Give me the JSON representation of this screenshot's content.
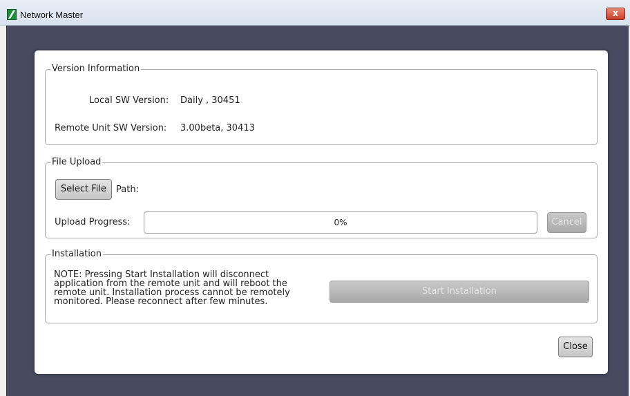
{
  "window": {
    "title": "Network Master",
    "close_glyph": "x"
  },
  "icons": {
    "app": "network-master-app-icon",
    "close": "close-icon"
  },
  "version_info": {
    "legend": "Version Information",
    "local_label": "Local SW Version:",
    "local_value": "Daily , 30451",
    "remote_label": "Remote Unit SW Version:",
    "remote_value": "3.00beta, 30413"
  },
  "file_upload": {
    "legend": "File Upload",
    "select_file_label": "Select File",
    "path_label": "Path:",
    "path_value": "",
    "progress_label": "Upload Progress:",
    "progress_text": "0%",
    "progress_value": 0,
    "cancel_label": "Cancel"
  },
  "installation": {
    "legend": "Installation",
    "note": "NOTE: Pressing Start Installation will disconnect\napplication from the remote unit and will reboot the\nremote unit. Installation process cannot be remotely\nmonitored. Please reconnect after few minutes.",
    "start_label": "Start Installation"
  },
  "footer": {
    "close_label": "Close"
  },
  "colors": {
    "backdrop": "#474a60",
    "progress_fill": "#7aa7d8",
    "disabled_button": "#b5b5b5"
  }
}
